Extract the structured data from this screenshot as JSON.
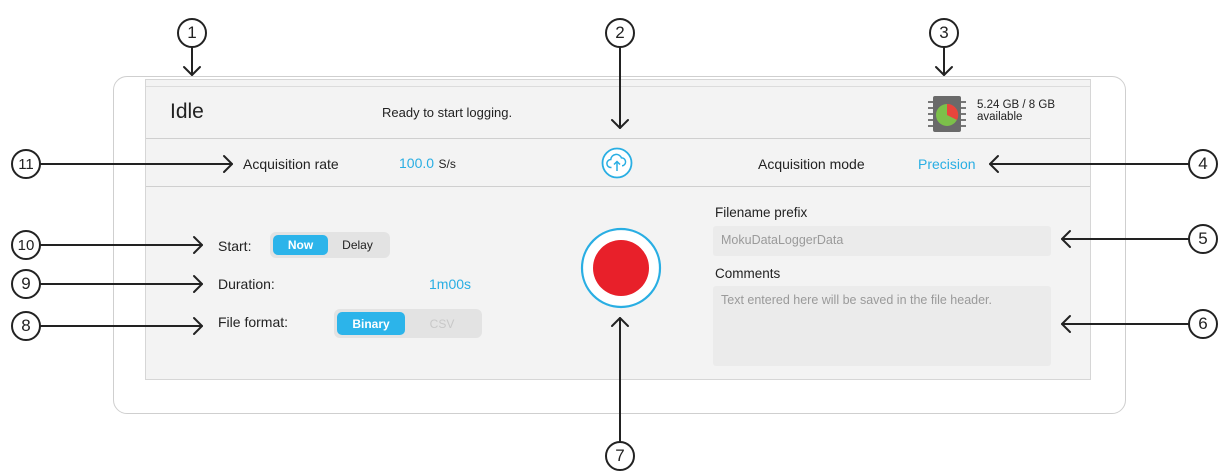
{
  "status": {
    "state": "Idle",
    "message": "Ready to start logging.",
    "storage_used": "5.24 GB / 8 GB",
    "storage_label": "available"
  },
  "settings": {
    "acq_rate_label": "Acquisition rate",
    "acq_rate_value": "100.0",
    "acq_rate_unit": "S/s",
    "acq_mode_label": "Acquisition mode",
    "acq_mode_value": "Precision"
  },
  "controls": {
    "start_label": "Start:",
    "start_options": [
      "Now",
      "Delay"
    ],
    "duration_label": "Duration:",
    "duration_value": "1m00s",
    "file_format_label": "File format:",
    "file_format_options": [
      "Binary",
      "CSV"
    ]
  },
  "file": {
    "prefix_label": "Filename prefix",
    "prefix_placeholder": "MokuDataLoggerData",
    "comments_label": "Comments",
    "comments_placeholder": "Text entered here will be saved in the file header."
  },
  "callouts": [
    "1",
    "2",
    "3",
    "4",
    "5",
    "6",
    "7",
    "8",
    "9",
    "10",
    "11"
  ],
  "colors": {
    "accent": "#29aee3",
    "record": "#e8202a",
    "storage_used": "#e8453c",
    "storage_free": "#7cc04a"
  },
  "icons": {
    "upload": "cloud-upload-icon",
    "storage": "memory-chip-icon",
    "record": "record-icon"
  }
}
